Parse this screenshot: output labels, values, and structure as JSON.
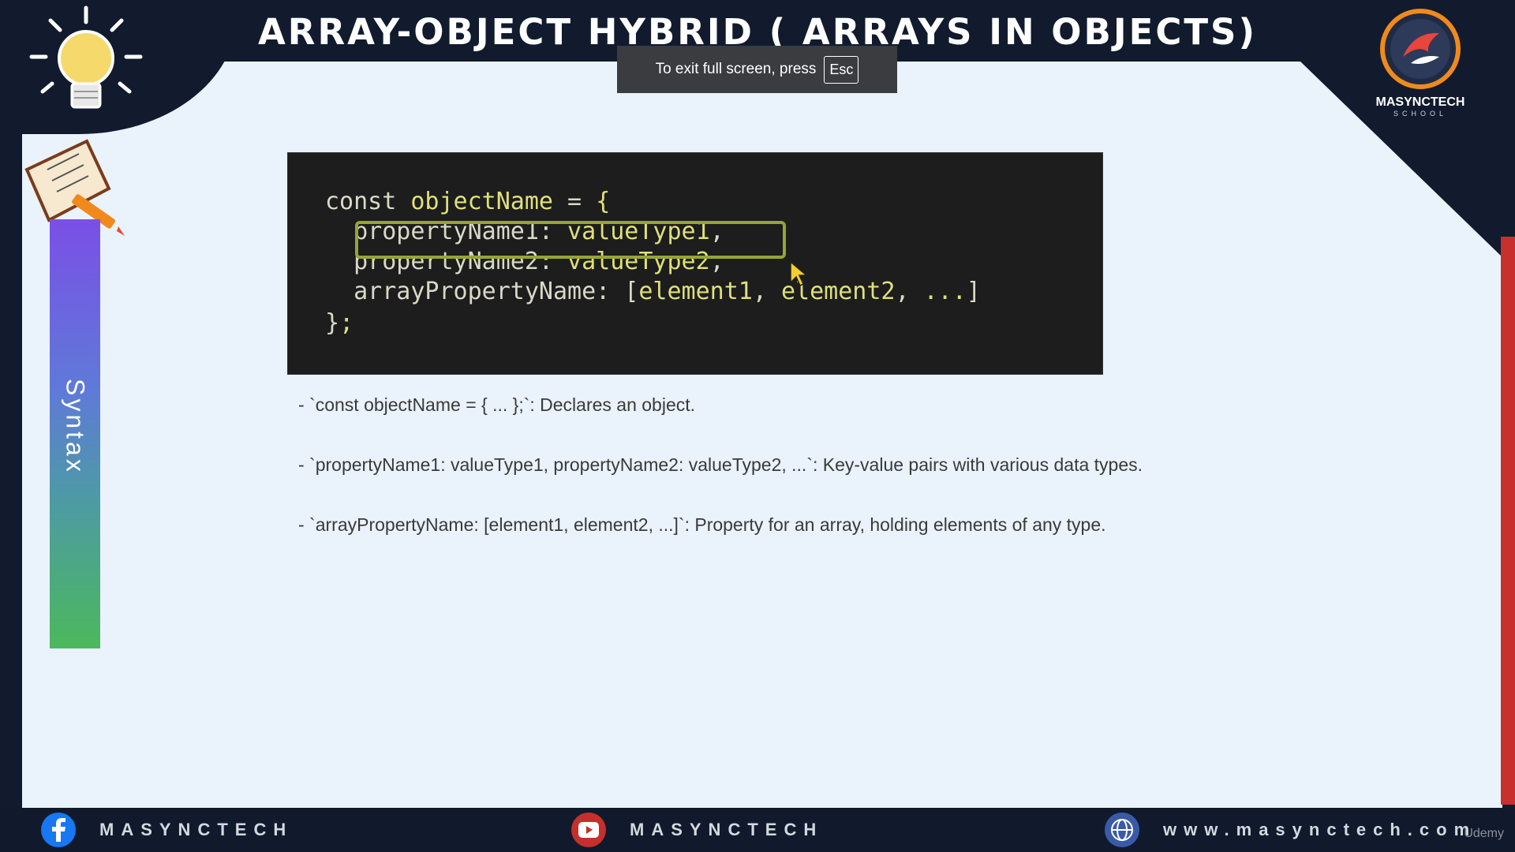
{
  "header": {
    "title": "ARRAY-OBJECT HYBRID ( ARRAYS IN OBJECTS)"
  },
  "logo": {
    "name": "MASYNCTECH",
    "sub": "SCHOOL"
  },
  "sidebar": {
    "label": "Syntax"
  },
  "code": {
    "lines": [
      "const objectName = {",
      "  propertyName1: valueType1,",
      "  propertyName2: valueType2,",
      "  arrayPropertyName: [element1, element2, ...]",
      "};"
    ]
  },
  "bullets": [
    "- `const objectName = { ... };`: Declares an object.",
    "- `propertyName1: valueType1, propertyName2: valueType2, ...`: Key-value pairs with various data types.",
    "- `arrayPropertyName: [element1, element2, ...]`: Property for an array, holding elements of any type."
  ],
  "fullscreen_toast": {
    "text": "To exit full screen, press",
    "key": "Esc"
  },
  "footer": {
    "facebook": "MASYNCTECH",
    "youtube": "MASYNCTECH",
    "website": "www.masynctech.com"
  },
  "watermark": "Udemy",
  "colors": {
    "background": "#111b2d",
    "slide": "#eaf2fb",
    "code_bg": "#1d1d1d",
    "highlight": "#96a436",
    "accent_red": "#c7302c"
  }
}
